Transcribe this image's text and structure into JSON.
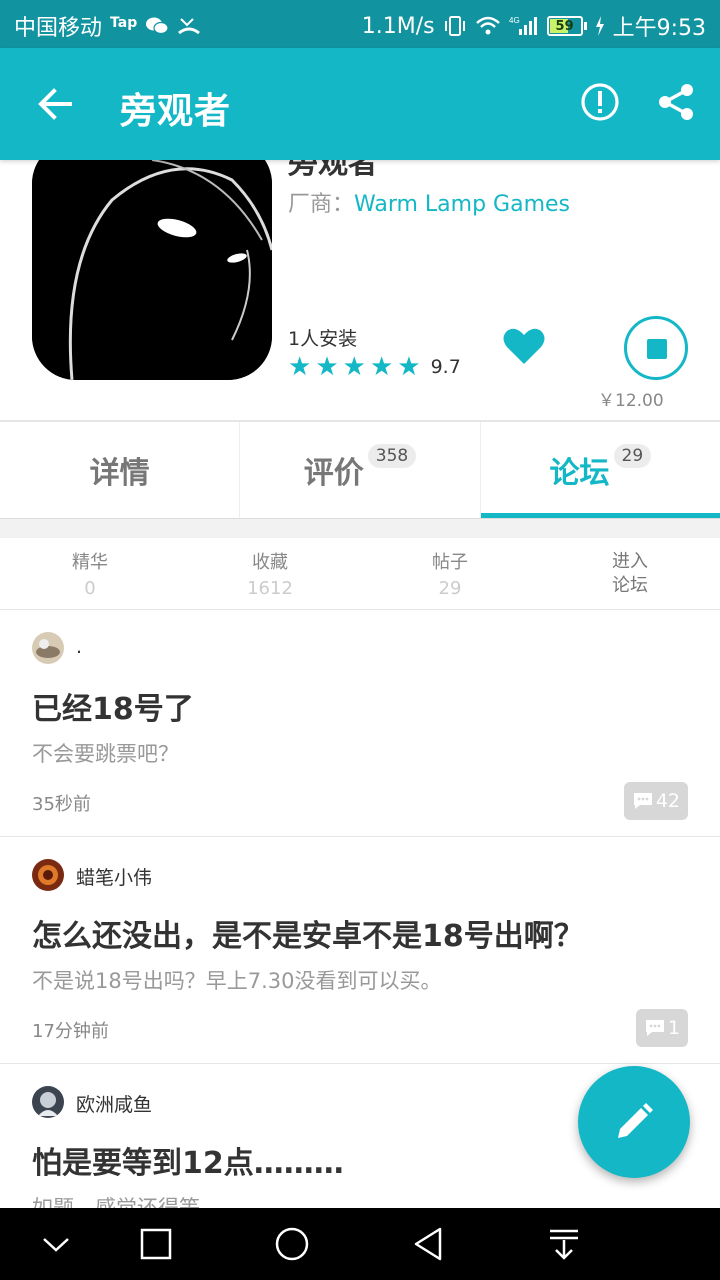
{
  "status_bar": {
    "carrier": "中国移动",
    "tap_label": "Tap",
    "speed": "1.1M/s",
    "network": "4G",
    "battery": "59",
    "time": "上午9:53"
  },
  "app_bar": {
    "title": "旁观者",
    "back_icon": "arrow-left-icon",
    "report_icon": "exclamation-circle-icon",
    "share_icon": "share-icon"
  },
  "game": {
    "name": "旁观者",
    "vendor_label": "厂商：",
    "vendor": "Warm Lamp Games",
    "installs": "1人安装",
    "rating": "9.7",
    "stars": 5,
    "price": "￥12.00"
  },
  "tabs": [
    {
      "label": "详情",
      "badge": ""
    },
    {
      "label": "评价",
      "badge": "358"
    },
    {
      "label": "论坛",
      "badge": "29",
      "active": true
    }
  ],
  "stats": [
    {
      "label": "精华",
      "value": "0"
    },
    {
      "label": "收藏",
      "value": "1612"
    },
    {
      "label": "帖子",
      "value": "29"
    }
  ],
  "enter_forum": {
    "line1": "进入",
    "line2": "论坛"
  },
  "posts": [
    {
      "author": ".",
      "title": "已经18号了",
      "excerpt": "不会要跳票吧？",
      "time": "35秒前",
      "comments": "42"
    },
    {
      "author": "蜡笔小伟",
      "title": "怎么还没出，是不是安卓不是18号出啊？",
      "excerpt": "不是说18号出吗？早上7.30没看到可以买。",
      "time": "17分钟前",
      "comments": "1"
    },
    {
      "author": "欧洲咸鱼",
      "title": "怕是要等到12点………",
      "excerpt": "如题，感觉还得等",
      "time": "",
      "comments": ""
    }
  ],
  "colors": {
    "accent": "#14b7c6",
    "status_bar": "#1193a0"
  }
}
